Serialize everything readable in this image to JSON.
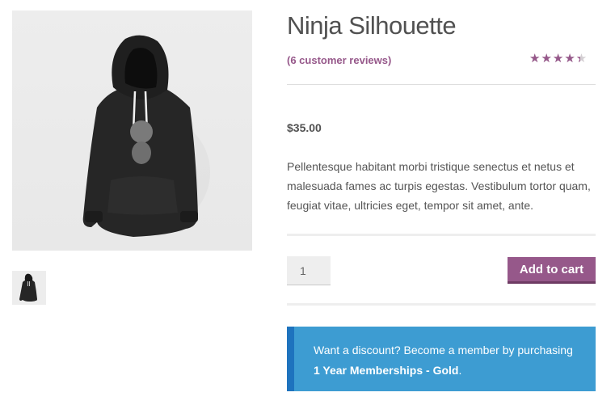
{
  "product": {
    "title": "Ninja Silhouette",
    "reviews_link": "(6 customer reviews)",
    "rating": 4.33,
    "rating_max": 5,
    "price": "$35.00",
    "description": "Pellentesque habitant morbi tristique senectus et netus et malesuada fames ac turpis egestas. Vestibulum tortor quam, feugiat vitae, ultricies eget, tempor sit amet, ante.",
    "main_image_icon": "black-hoodie-image",
    "thumbnail_icon": "black-hoodie-thumbnail"
  },
  "cart": {
    "quantity_value": "1",
    "add_to_cart_label": "Add to cart"
  },
  "notice": {
    "text_before": "Want a discount? Become a member by purchasing ",
    "highlight": "1 Year Memberships - Gold",
    "text_after": "."
  },
  "colors": {
    "accent": "#96588a",
    "notice_bg": "#3d9cd2",
    "notice_border": "#1e73be"
  }
}
